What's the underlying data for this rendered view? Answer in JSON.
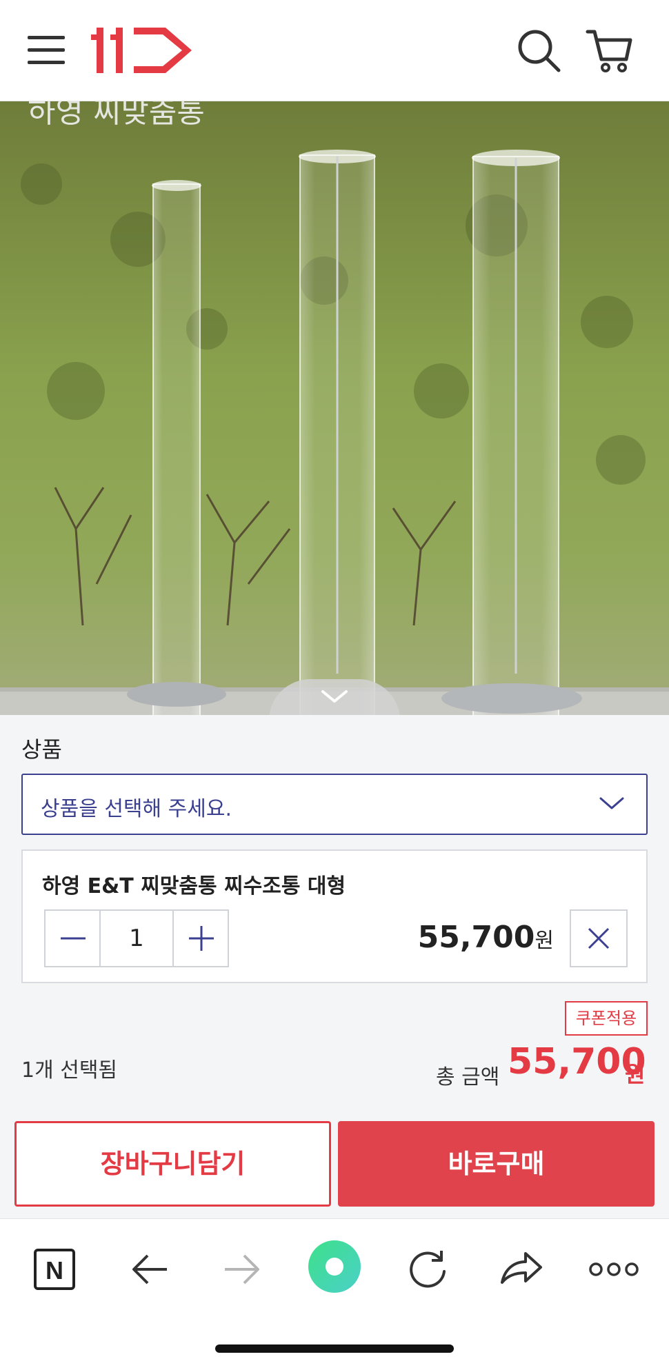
{
  "header": {
    "menu_icon": "hamburger-menu-icon",
    "logo_text": "11",
    "brand_color": "#e33a44",
    "search_icon": "search-icon",
    "cart_icon": "cart-icon"
  },
  "product_image": {
    "caption": "하영 찌맞춤통"
  },
  "options": {
    "section_label": "상품",
    "select_placeholder": "상품을 선택해 주세요.",
    "item": {
      "name": "하영 E&T 찌맞춤통 찌수조통 대형",
      "quantity": "1",
      "price": "55,700",
      "price_unit": "원"
    },
    "coupon_label": "쿠폰적용",
    "selected_count": "1개 선택됨",
    "total_label": "총 금액",
    "total_value": "55,700",
    "total_unit": "원"
  },
  "actions": {
    "cart_label": "장바구니담기",
    "buy_label": "바로구매",
    "accent_color": "#e0434b"
  },
  "browser_toolbar": {
    "n_label": "N"
  }
}
